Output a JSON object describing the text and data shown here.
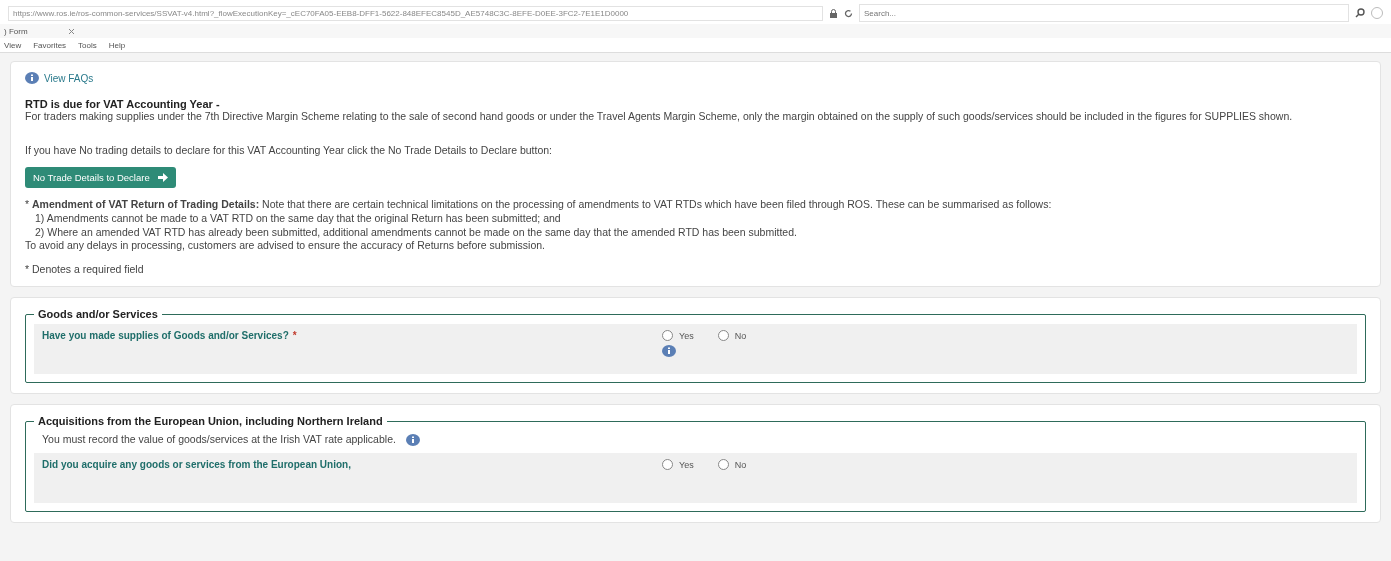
{
  "browser": {
    "url": "https://www.ros.ie/ros-common-services/SSVAT-v4.html?_flowExecutionKey=_cEC70FA05-EEB8-DFF1-5622-848EFEC8545D_AE5748C3C-8EFE-D0EE-3FC2-7E1E1D0000",
    "search_placeholder": "Search...",
    "tab_title": ") Form",
    "menu": [
      "View",
      "Favorites",
      "Tools",
      "Help"
    ]
  },
  "intro": {
    "faq_link": "View FAQs",
    "heading": "RTD is due for VAT Accounting Year -",
    "paragraph": "For traders making supplies under the 7th Directive Margin Scheme relating to the sale of second hand goods or under the Travel Agents Margin Scheme, only the margin obtained on the supply of such goods/services should be included in the figures for SUPPLIES shown.",
    "no_trade_text": "If you have No trading details to declare for this VAT Accounting Year click the No Trade Details to Declare button:",
    "no_trade_button": "No Trade Details to Declare",
    "amendment": "* **Amendment of VAT Return of Trading Details:** Note that there are certain technical limitations on the processing of amendments to VAT RTDs which have been filed through ROS. These can be summarised as follows:",
    "amendment_points": [
      "1)  Amendments cannot be made to a VAT RTD on the same day that the original Return has been submitted; and",
      "2)  Where an amended VAT RTD has already been submitted, additional amendments cannot be made on the same day that the amended RTD has been submitted."
    ],
    "amendment_footer": "To avoid any delays in processing, customers are advised to ensure the accuracy of Returns before submission.",
    "required_note": "* Denotes a required field"
  },
  "sections": [
    {
      "legend": "Goods and/or Services",
      "question": "Have you made supplies of Goods and/or Services?",
      "required_mark": "*",
      "show_info": true,
      "options": [
        {
          "label": "Yes",
          "selected": false
        },
        {
          "label": "No",
          "selected": false
        }
      ]
    },
    {
      "legend": "Acquisitions from the European Union, including Northern Ireland",
      "note": "You must record the value of goods/services at the Irish VAT rate applicable.",
      "question": "Did you acquire any goods or services from the European Union,",
      "show_info": false,
      "options": [
        {
          "label": "Yes",
          "selected": false
        },
        {
          "label": "No",
          "selected": false
        }
      ]
    }
  ]
}
